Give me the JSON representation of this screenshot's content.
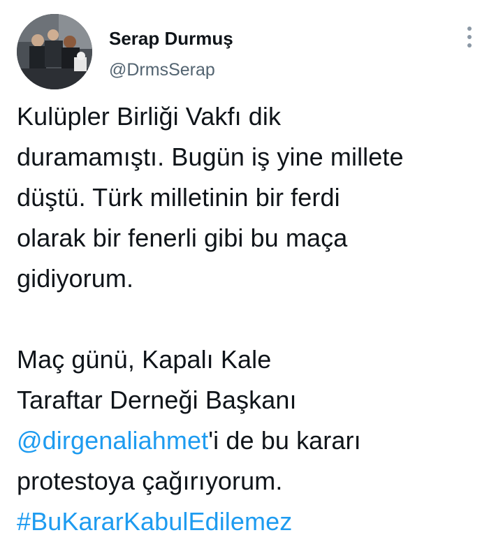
{
  "author": {
    "display_name": "Serap Durmuş",
    "handle": "@DrmsSerap"
  },
  "tweet": {
    "paragraph1": [
      "Kulüpler Birliği Vakfı dik",
      "duramamıştı. Bugün iş yine millete",
      "düştü. Türk milletinin bir ferdi",
      "olarak bir fenerli gibi bu maça",
      "gidiyorum."
    ],
    "paragraph2_line1": "Maç günü, Kapalı Kale",
    "paragraph2_line2": "Taraftar Derneği Başkanı",
    "mention": "@dirgenaliahmet",
    "mention_suffix": "'i de bu kararı",
    "paragraph2_line4": "protestoya çağırıyorum.",
    "hashtag": "#BuKararKabulEdilemez"
  },
  "icons": {
    "more": "more-vertical-icon"
  },
  "colors": {
    "text": "#0f1419",
    "secondary": "#536471",
    "link": "#1d9bf0"
  }
}
